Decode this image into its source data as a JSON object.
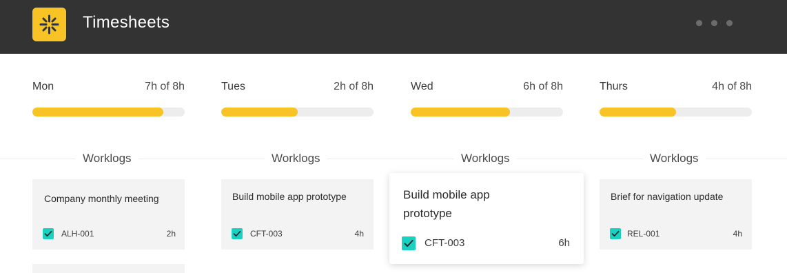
{
  "app": {
    "title": "Timesheets"
  },
  "colors": {
    "accent": "#f7c325",
    "check": "#18d1c1",
    "topbar": "#333333"
  },
  "days": [
    {
      "name": "Mon",
      "hours": "7h of 8h",
      "progress": 0.86
    },
    {
      "name": "Tues",
      "hours": "2h of 8h",
      "progress": 0.5
    },
    {
      "name": "Wed",
      "hours": "6h of 8h",
      "progress": 0.65
    },
    {
      "name": "Thurs",
      "hours": "4h of 8h",
      "progress": 0.5
    }
  ],
  "worklogs_label": "Worklogs",
  "cards": [
    {
      "title": "Company monthly meeting",
      "code": "ALH-001",
      "hours": "2h",
      "checked": true
    },
    {
      "title": "Build mobile app prototype",
      "code": "CFT-003",
      "hours": "4h",
      "checked": true
    },
    {
      "title": "Build mobile app prototype",
      "code": "CFT-003",
      "hours": "6h",
      "checked": true
    },
    {
      "title": "Brief for navigation update",
      "code": "REL-001",
      "hours": "4h",
      "checked": true
    }
  ]
}
